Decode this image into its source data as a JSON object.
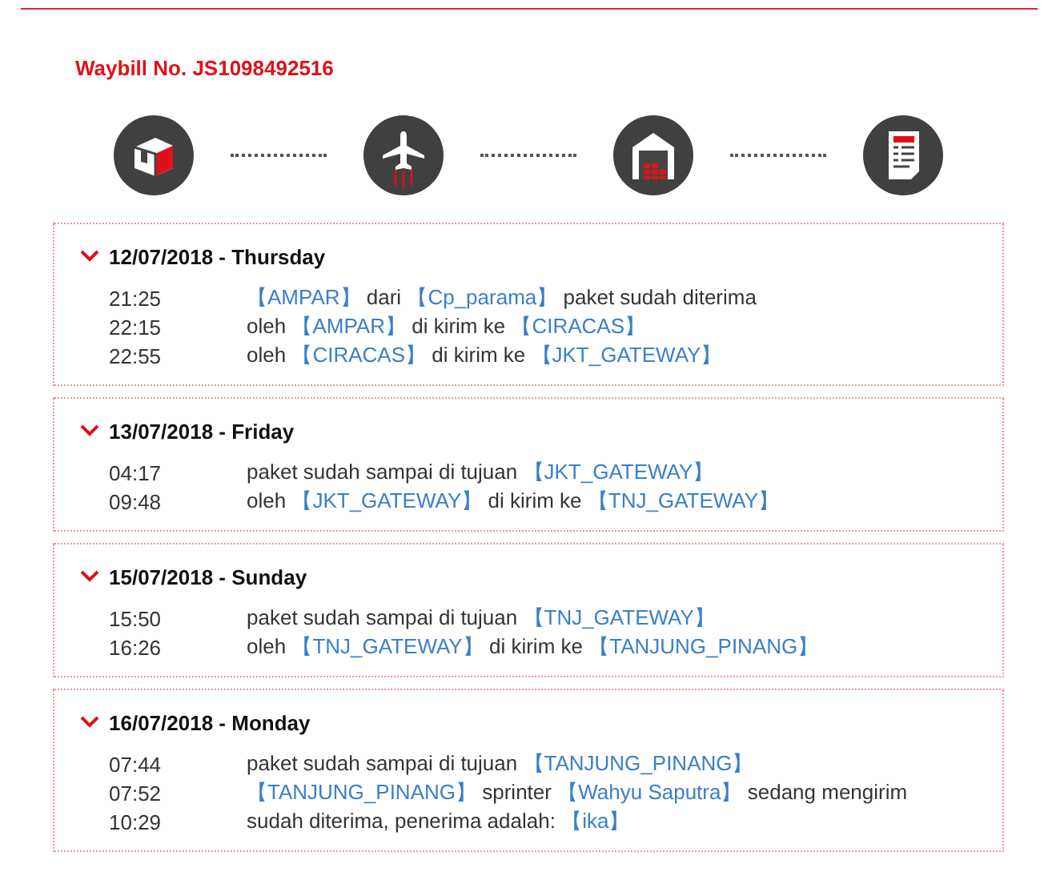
{
  "waybill": "Waybill No. JS1098492516",
  "steps": [
    {
      "kind": "box"
    },
    {
      "kind": "plane"
    },
    {
      "kind": "warehouse"
    },
    {
      "kind": "document"
    }
  ],
  "days": [
    {
      "date": "12/07/2018 - Thursday",
      "expanded": true,
      "events": [
        {
          "time": "21:25",
          "parts": [
            {
              "kind": "place",
              "text": "【AMPAR】"
            },
            {
              "kind": "plain",
              "text": "dari"
            },
            {
              "kind": "place",
              "text": "【Cp_parama】"
            },
            {
              "kind": "plain",
              "text": "paket sudah diterima"
            }
          ]
        },
        {
          "time": "22:15",
          "parts": [
            {
              "kind": "plain",
              "text": "oleh"
            },
            {
              "kind": "place",
              "text": "【AMPAR】"
            },
            {
              "kind": "plain",
              "text": "di kirim ke"
            },
            {
              "kind": "place",
              "text": "【CIRACAS】"
            }
          ]
        },
        {
          "time": "22:55",
          "parts": [
            {
              "kind": "plain",
              "text": "oleh"
            },
            {
              "kind": "place",
              "text": "【CIRACAS】"
            },
            {
              "kind": "plain",
              "text": "di kirim ke"
            },
            {
              "kind": "place",
              "text": "【JKT_GATEWAY】"
            }
          ]
        }
      ]
    },
    {
      "date": "13/07/2018 - Friday",
      "expanded": true,
      "events": [
        {
          "time": "04:17",
          "parts": [
            {
              "kind": "plain",
              "text": "paket sudah sampai di tujuan"
            },
            {
              "kind": "place",
              "text": "【JKT_GATEWAY】"
            }
          ]
        },
        {
          "time": "09:48",
          "parts": [
            {
              "kind": "plain",
              "text": "oleh"
            },
            {
              "kind": "place",
              "text": "【JKT_GATEWAY】"
            },
            {
              "kind": "plain",
              "text": "di kirim ke"
            },
            {
              "kind": "place",
              "text": "【TNJ_GATEWAY】"
            }
          ]
        }
      ]
    },
    {
      "date": "15/07/2018 - Sunday",
      "expanded": true,
      "events": [
        {
          "time": "15:50",
          "parts": [
            {
              "kind": "plain",
              "text": "paket sudah sampai di tujuan"
            },
            {
              "kind": "place",
              "text": "【TNJ_GATEWAY】"
            }
          ]
        },
        {
          "time": "16:26",
          "parts": [
            {
              "kind": "plain",
              "text": "oleh"
            },
            {
              "kind": "place",
              "text": "【TNJ_GATEWAY】"
            },
            {
              "kind": "plain",
              "text": "di kirim ke"
            },
            {
              "kind": "place",
              "text": "【TANJUNG_PINANG】"
            }
          ]
        }
      ]
    },
    {
      "date": "16/07/2018 - Monday",
      "expanded": true,
      "events": [
        {
          "time": "07:44",
          "parts": [
            {
              "kind": "plain",
              "text": "paket sudah sampai di tujuan"
            },
            {
              "kind": "place",
              "text": "【TANJUNG_PINANG】"
            }
          ]
        },
        {
          "time": "07:52",
          "parts": [
            {
              "kind": "place",
              "text": "【TANJUNG_PINANG】"
            },
            {
              "kind": "plain",
              "text": "sprinter"
            },
            {
              "kind": "place",
              "text": "【Wahyu Saputra】"
            },
            {
              "kind": "plain",
              "text": "sedang mengirim"
            }
          ]
        },
        {
          "time": "10:29",
          "parts": [
            {
              "kind": "plain",
              "text": "sudah diterima, penerima adalah:"
            },
            {
              "kind": "place",
              "text": "【ika】"
            }
          ]
        }
      ]
    }
  ]
}
